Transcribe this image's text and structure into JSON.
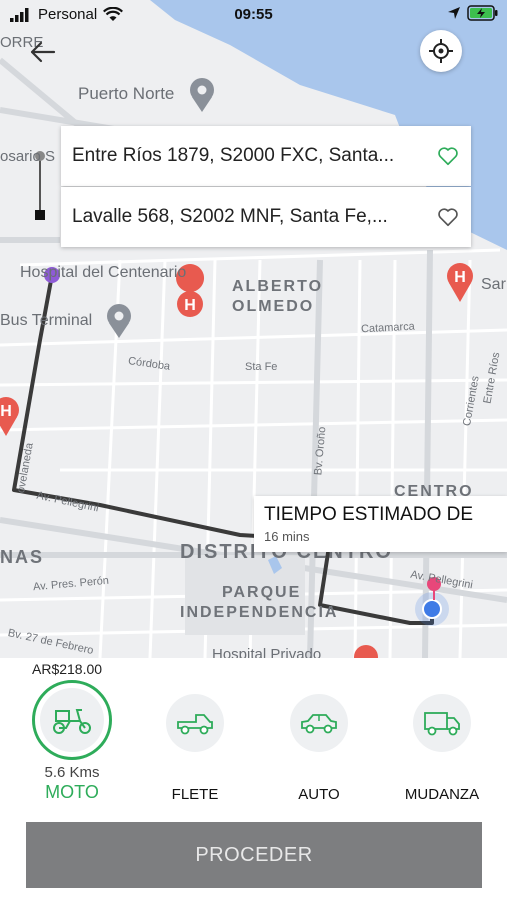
{
  "status_bar": {
    "carrier": "Personal",
    "time": "09:55"
  },
  "map": {
    "labels": {
      "puerto_norte": "Puerto Norte",
      "hospital_centenario": "Hospital del Centenario",
      "bus_terminal": "Bus Terminal",
      "alberto_olmedo_1": "ALBERTO",
      "alberto_olmedo_2": "OLMEDO",
      "centro": "CENTRO",
      "distrito_centro": "DISTRITO CENTRO",
      "parque_1": "PARQUE",
      "parque_2": "INDEPENDENCIA",
      "hospital_privado": "Hospital Privado",
      "sar": "Sar",
      "rosario_fragment": "osario S",
      "torre_fragment": "ORRE",
      "nas_fragment": "NAS",
      "catamarca": "Catamarca",
      "cordoba": "Córdoba",
      "sta_fe": "Sta Fe",
      "corrientes": "Corrientes",
      "entre_rios": "Entre Ríos",
      "bv_orono": "Bv. Oroño",
      "av_pellegrini": "Av. Pellegrini",
      "av_pellegrini_2": "Av. Pellegrini",
      "av_pres_peron": "Av. Pres. Perón",
      "bv_27_febrero": "Bv. 27 de Febrero",
      "ovelaneda": "ovelaneda"
    },
    "route_color": "#3a3a3a",
    "water_color": "#a9c6ec"
  },
  "origin": {
    "address": "Entre Ríos 1879, S2000 FXC, Santa..."
  },
  "destination": {
    "address": "Lavalle 568, S2002 MNF, Santa Fe,..."
  },
  "eta": {
    "title": "TIEMPO ESTIMADO DE",
    "duration": "16 mins"
  },
  "price": "AR$218.00",
  "vehicles": [
    {
      "label": "MOTO",
      "distance": "5.6 Kms",
      "icon": "scooter-icon",
      "selected": true
    },
    {
      "label": "FLETE",
      "icon": "pickup-truck-icon",
      "selected": false
    },
    {
      "label": "AUTO",
      "icon": "car-icon",
      "selected": false
    },
    {
      "label": "MUDANZA",
      "icon": "moving-truck-icon",
      "selected": false
    }
  ],
  "proceed_label": "PROCEDER",
  "colors": {
    "accent": "#2eac5a",
    "button": "#7d7e80"
  }
}
